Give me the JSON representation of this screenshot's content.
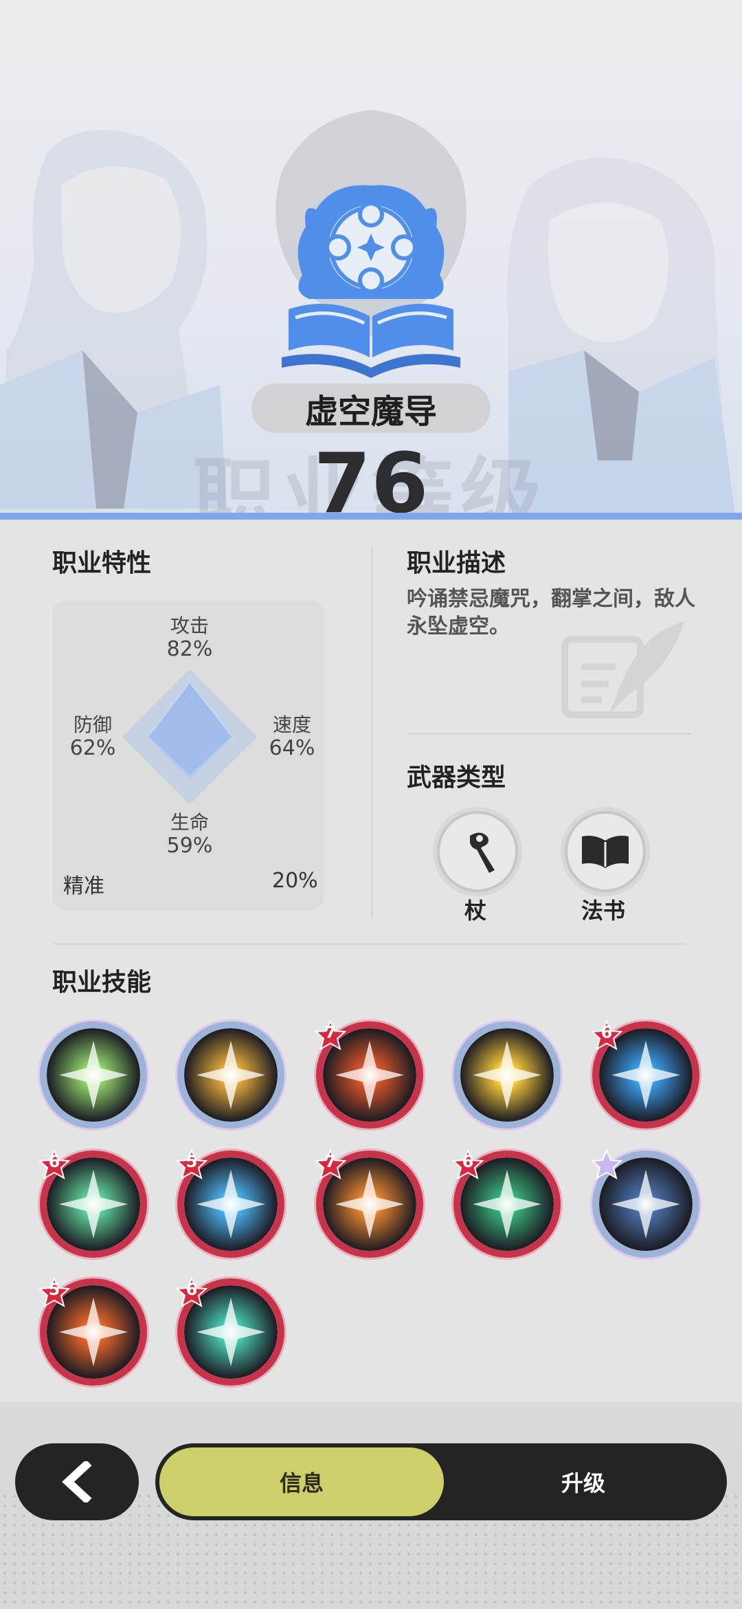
{
  "header": {
    "class_name": "虚空魔导",
    "class_level": "76",
    "watermark": "职业等级"
  },
  "traits": {
    "title": "职业特性",
    "attack_label": "攻击",
    "attack_value": "82%",
    "defense_label": "防御",
    "defense_value": "62%",
    "speed_label": "速度",
    "speed_value": "64%",
    "health_label": "生命",
    "health_value": "59%",
    "precision_label": "精准",
    "precision_value": "20%",
    "radar": {
      "attack": 0.82,
      "defense": 0.62,
      "speed": 0.64,
      "health": 0.59
    }
  },
  "description": {
    "title": "职业描述",
    "text": "吟诵禁忌魔咒，翻掌之间，敌人永坠虚空。"
  },
  "weapons": {
    "title": "武器类型",
    "items": [
      {
        "label": "杖",
        "icon": "staff-icon"
      },
      {
        "label": "法书",
        "icon": "spellbook-icon"
      }
    ]
  },
  "skills": {
    "title": "职业技能",
    "items": [
      {
        "icon": "green-burst-icon",
        "color": "#8fd16a",
        "ring": "rainbow",
        "badge": ""
      },
      {
        "icon": "golden-halo-icon",
        "color": "#e0a83a",
        "ring": "rainbow",
        "badge": ""
      },
      {
        "icon": "fire-diamond-icon",
        "color": "#d8552a",
        "ring": "red",
        "badge": "7"
      },
      {
        "icon": "golden-star-icon",
        "color": "#f2c73a",
        "ring": "rainbow",
        "badge": ""
      },
      {
        "icon": "ice-crystal-icon",
        "color": "#3a9be8",
        "ring": "red",
        "badge": "6"
      },
      {
        "icon": "green-shuriken-icon",
        "color": "#5ccc96",
        "ring": "red",
        "badge": "6"
      },
      {
        "icon": "ice-flower-icon",
        "color": "#4aaee8",
        "ring": "red",
        "badge": "5"
      },
      {
        "icon": "flame-swirl-icon",
        "color": "#e4842e",
        "ring": "red",
        "badge": "7"
      },
      {
        "icon": "green-dash-icon",
        "color": "#36b07a",
        "ring": "red",
        "badge": "6"
      },
      {
        "icon": "void-meditation-icon",
        "color": "#4a6fa8",
        "ring": "rainbow",
        "badge": "star"
      },
      {
        "icon": "fire-figure-icon",
        "color": "#e4642a",
        "ring": "red",
        "badge": "5"
      },
      {
        "icon": "teal-clover-icon",
        "color": "#48c8b0",
        "ring": "red",
        "badge": "6"
      }
    ]
  },
  "nav": {
    "back_icon": "chevron-left-icon",
    "tab_info": "信息",
    "tab_upgrade": "升级"
  },
  "colors": {
    "accent_blue": "#7fa6e8",
    "active_tab": "#cdd06a",
    "bar_dark": "#242424",
    "red_ring": "#c7334b"
  }
}
